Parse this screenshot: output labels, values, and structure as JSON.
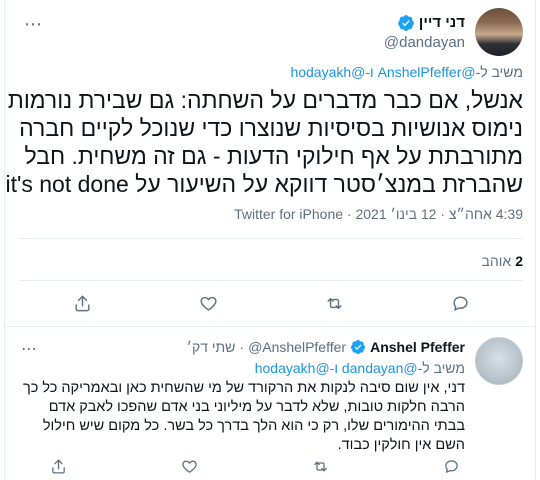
{
  "main_tweet": {
    "author_name": "דני דיין",
    "author_handle": "@dandayan",
    "more_icon": "more-icon",
    "reply_to_prefix": "משיב ל-",
    "reply_to_users": "@AnshelPfeffer ו-@hodayakh",
    "text_lines": [
      "אנשל, אם כבר מדברים על השחתה: גם שבירת נורמות",
      "נימוס אנושיות בסיסיות שנוצרו כדי שנוכל לקיים חברה",
      "מתורבתת  על אף חילוקי הדעות - גם זה משחית. חבל",
      "שהברזת במנצ׳סטר דווקא על השיעור על it's not done"
    ],
    "meta": "4:39 אחה״צ · 12 בינו׳ 2021 · Twitter for iPhone",
    "likes_count": "2",
    "likes_label": "אוהב",
    "actions": [
      "reply-icon",
      "retweet-icon",
      "like-icon",
      "share-icon"
    ]
  },
  "reply_tweet": {
    "author_name": "Anshel Pfeffer",
    "author_handle": "@AnshelPfeffer",
    "dot": "·",
    "date": "שתי דק׳",
    "reply_to_prefix": "משיב ל-",
    "reply_to_users": "@dandayan ו-@hodayakh",
    "text_lines": [
      "דני, אין שום סיבה לנקות את הרקורד של מי שהשחית כאן ובאמריקה כל כך",
      "הרבה חלקות טובות, שלא לדבר על מיליוני בני אדם שהפכו לאבק אדם",
      "בבתי ההימורים שלו, רק כי הוא הלך בדרך כל בשר. כל מקום שיש חילול",
      "השם אין חולקין כבוד."
    ],
    "actions": [
      "reply-icon",
      "retweet-icon",
      "like-icon",
      "share-icon"
    ]
  },
  "colors": {
    "accent": "#1b95e0",
    "secondary_text": "#5b7083",
    "border": "#e6ecf0"
  }
}
